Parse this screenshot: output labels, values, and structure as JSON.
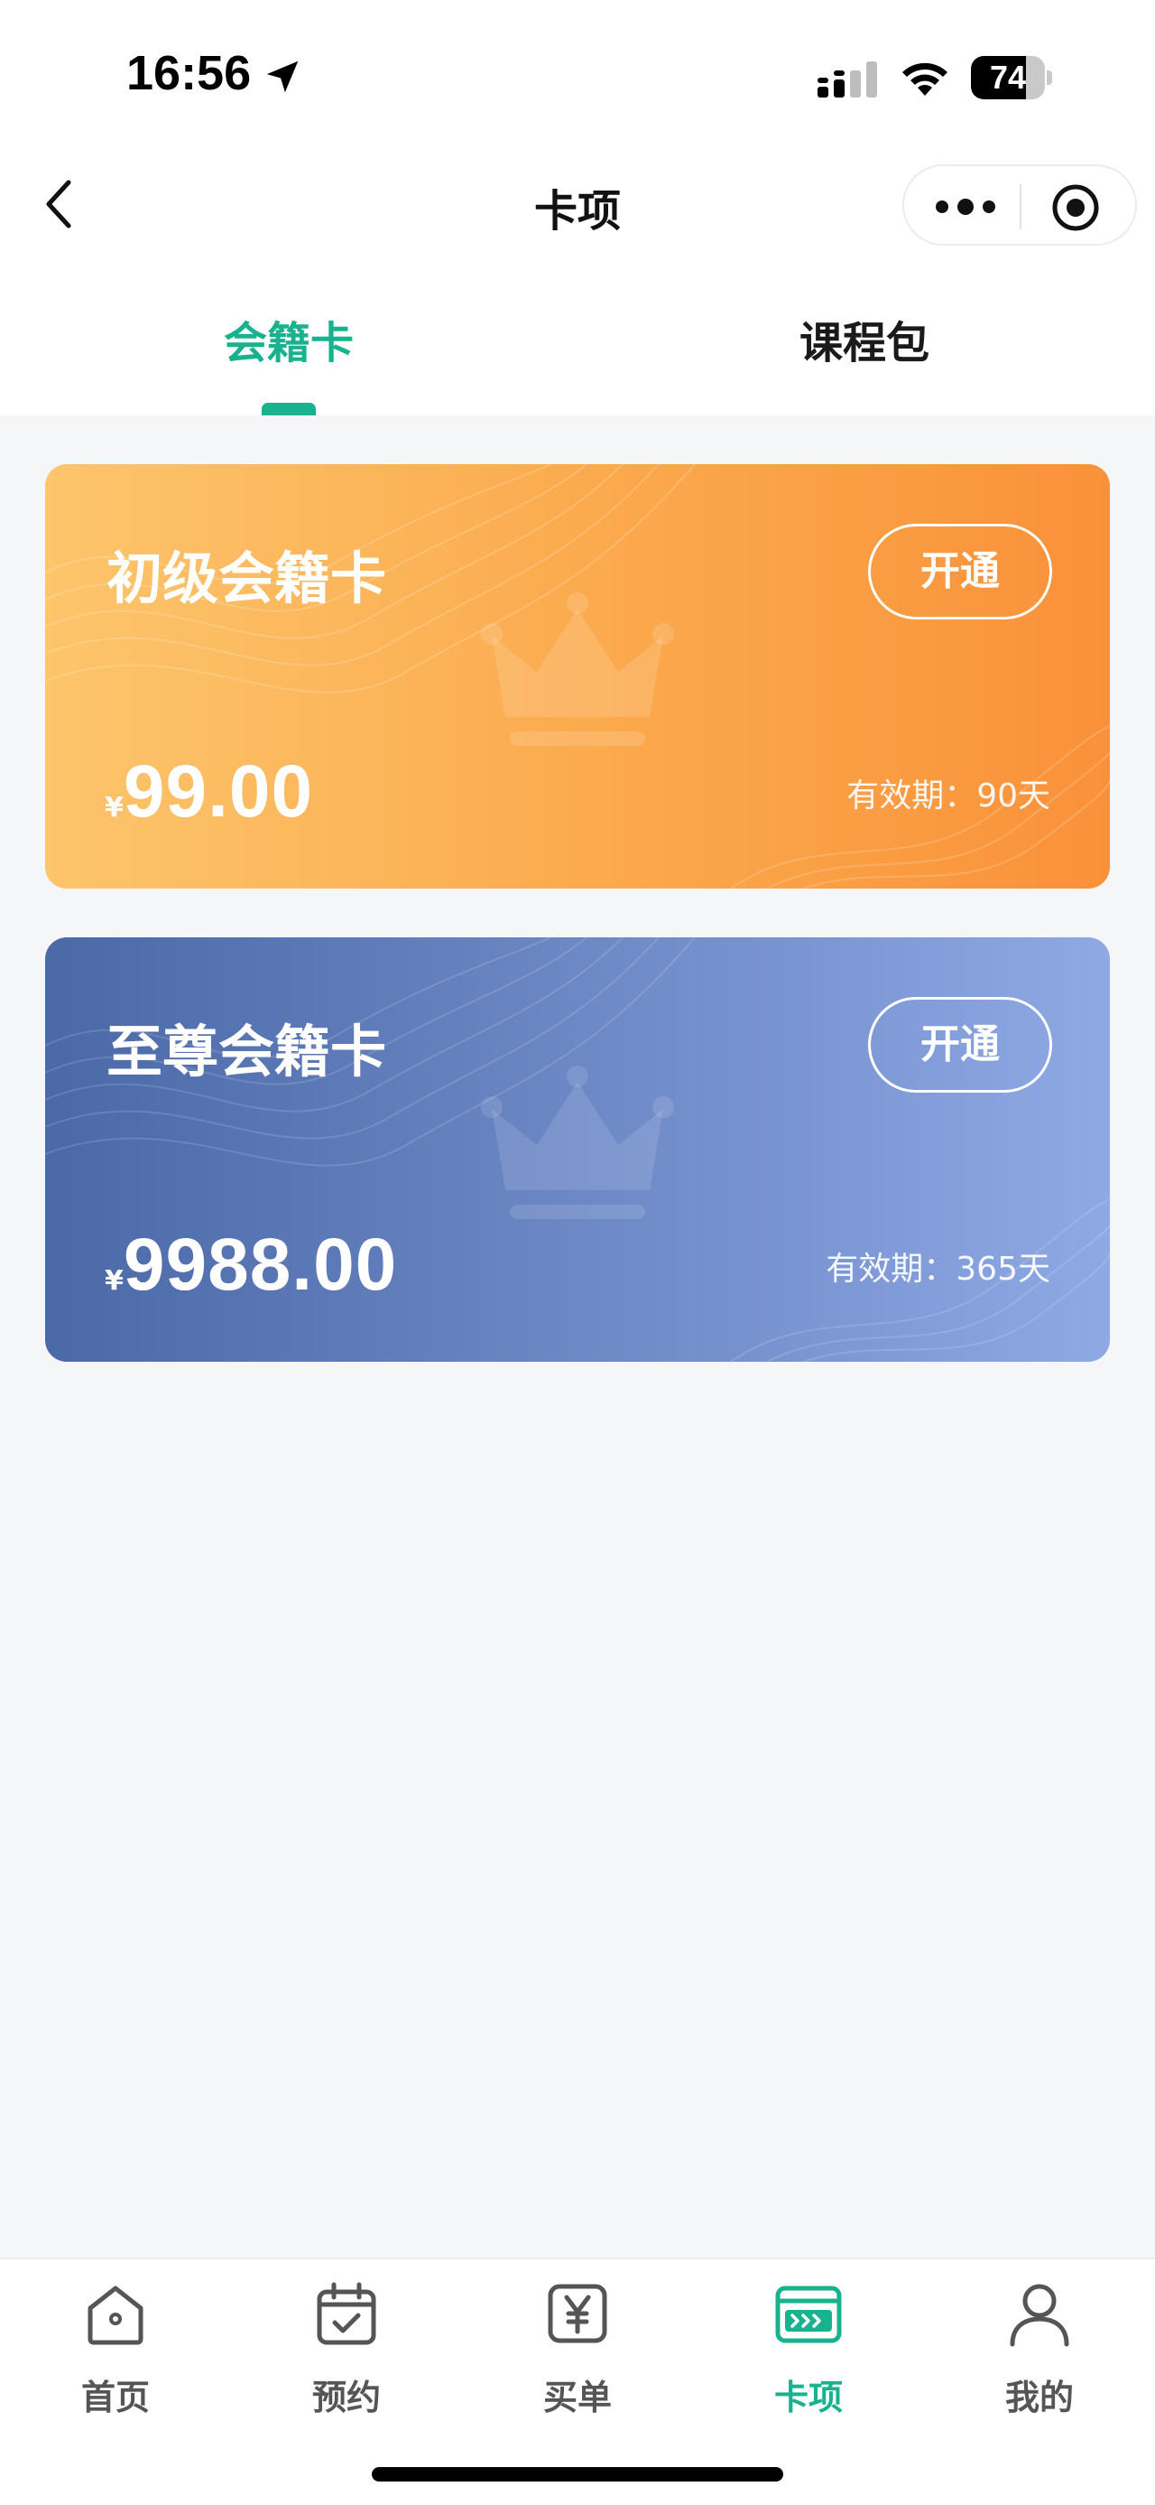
{
  "status_bar": {
    "time": "16:56",
    "battery_level": "74",
    "battery_fraction": 0.74
  },
  "nav": {
    "title": "卡项"
  },
  "tabs": [
    {
      "label": "会籍卡",
      "active": true
    },
    {
      "label": "课程包",
      "active": false
    }
  ],
  "cards": [
    {
      "name": "初级会籍卡",
      "button_label": "开通",
      "currency_symbol": "¥",
      "price": "99.00",
      "validity": "有效期：90天",
      "colors": [
        "#fdc56c",
        "#f9913a"
      ]
    },
    {
      "name": "至尊会籍卡",
      "button_label": "开通",
      "currency_symbol": "¥",
      "price": "9988.00",
      "validity": "有效期：365天",
      "colors": [
        "#4b69a7",
        "#8ea9e4"
      ]
    }
  ],
  "tabbar": {
    "items": [
      {
        "label": "首页",
        "icon": "home-icon",
        "active": false
      },
      {
        "label": "预约",
        "icon": "calendar-check-icon",
        "active": false
      },
      {
        "label": "买单",
        "icon": "yuan-icon",
        "active": false
      },
      {
        "label": "卡项",
        "icon": "card-icon",
        "active": true
      },
      {
        "label": "我的",
        "icon": "user-icon",
        "active": false
      }
    ]
  },
  "colors": {
    "accent": "#18b28e",
    "background": "#f5f6f8"
  }
}
